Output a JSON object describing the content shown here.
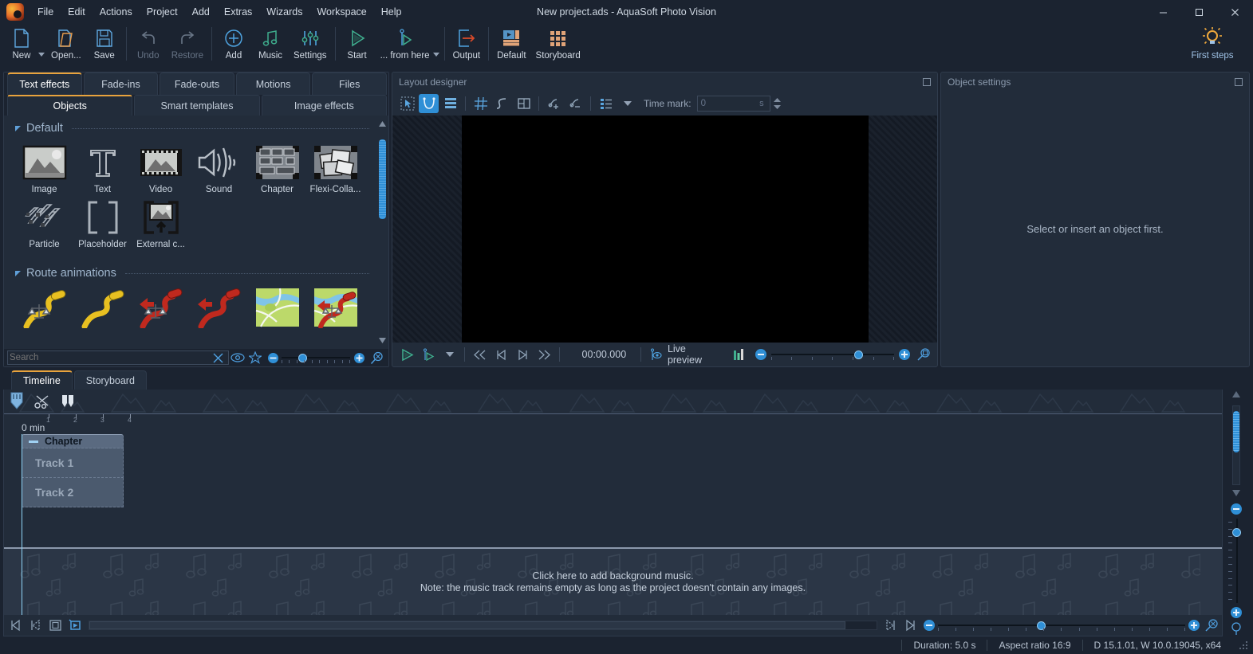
{
  "window": {
    "title": "New project.ads - AquaSoft Photo Vision",
    "minimize": "─",
    "maximize": "□",
    "close": "✕"
  },
  "menubar": {
    "items": [
      {
        "label": "File"
      },
      {
        "label": "Edit"
      },
      {
        "label": "Actions"
      },
      {
        "label": "Project"
      },
      {
        "label": "Add"
      },
      {
        "label": "Extras"
      },
      {
        "label": "Wizards"
      },
      {
        "label": "Workspace"
      },
      {
        "label": "Help"
      }
    ]
  },
  "ribbon": {
    "buttons": [
      {
        "label": "New",
        "icon": "new-document-icon",
        "disabled": false
      },
      {
        "label": "Open...",
        "icon": "open-folder-icon",
        "disabled": false
      },
      {
        "label": "Save",
        "icon": "floppy-disk-icon",
        "disabled": false
      },
      {
        "label": "Undo",
        "icon": "undo-arrow-icon",
        "disabled": true
      },
      {
        "label": "Restore",
        "icon": "redo-arrow-icon",
        "disabled": true
      },
      {
        "label": "Add",
        "icon": "plus-circle-icon",
        "disabled": false
      },
      {
        "label": "Music",
        "icon": "music-note-icon",
        "disabled": false
      },
      {
        "label": "Settings",
        "icon": "sliders-icon",
        "disabled": false
      },
      {
        "label": "Start",
        "icon": "play-triangle-icon",
        "disabled": false
      },
      {
        "label": "... from here",
        "icon": "play-from-here-icon",
        "disabled": false
      },
      {
        "label": "Output",
        "icon": "export-arrow-icon",
        "disabled": false
      },
      {
        "label": "Default",
        "icon": "default-layout-icon",
        "disabled": false
      },
      {
        "label": "Storyboard",
        "icon": "storyboard-grid-icon",
        "disabled": false
      }
    ],
    "first_steps": {
      "label": "First steps",
      "icon": "lightbulb-icon"
    }
  },
  "toolbox": {
    "tabs_row1": [
      {
        "label": "Text effects",
        "active": true
      },
      {
        "label": "Fade-ins",
        "active": false
      },
      {
        "label": "Fade-outs",
        "active": false
      },
      {
        "label": "Motions",
        "active": false
      },
      {
        "label": "Files",
        "active": false
      }
    ],
    "tabs_row2": [
      {
        "label": "Objects",
        "active": true
      },
      {
        "label": "Smart templates",
        "active": false
      },
      {
        "label": "Image effects",
        "active": false
      }
    ],
    "groups": [
      {
        "title": "Default",
        "items": [
          {
            "label": "Image",
            "icon": "image-thumb-icon"
          },
          {
            "label": "Text",
            "icon": "text-t-icon"
          },
          {
            "label": "Video",
            "icon": "video-filmstrip-icon"
          },
          {
            "label": "Sound",
            "icon": "speaker-wave-icon"
          },
          {
            "label": "Chapter",
            "icon": "chapter-blocks-icon"
          },
          {
            "label": "Flexi-Colla...",
            "icon": "flexi-collage-icon"
          },
          {
            "label": "Particle",
            "icon": "particle-icon"
          },
          {
            "label": "Placeholder",
            "icon": "placeholder-brackets-icon"
          },
          {
            "label": "External c...",
            "icon": "external-content-icon"
          }
        ]
      },
      {
        "title": "Route animations",
        "items": [
          {
            "label": "",
            "icon": "route-yellow-scale-icon"
          },
          {
            "label": "",
            "icon": "route-yellow-icon"
          },
          {
            "label": "",
            "icon": "route-red-scale-icon"
          },
          {
            "label": "",
            "icon": "route-red-icon"
          },
          {
            "label": "",
            "icon": "route-map-icon"
          },
          {
            "label": "",
            "icon": "route-map-red-icon"
          }
        ]
      }
    ],
    "search": {
      "placeholder": "Search",
      "value": "",
      "clear_icon": "clear-x-icon",
      "preview_icon": "eye-icon",
      "favorite_icon": "star-icon",
      "zoom_out_icon": "minus-circle-icon",
      "zoom_in_icon": "plus-circle-icon",
      "reset_zoom_icon": "magnifier-reset-icon",
      "zoom_value": 25
    }
  },
  "layout_designer": {
    "title": "Layout designer",
    "restore_icon": "restore-window-icon",
    "tools": [
      {
        "icon": "select-marquee-icon",
        "active": false
      },
      {
        "icon": "curve-tool-icon",
        "active": true
      },
      {
        "icon": "layers-icon",
        "active": false
      },
      {
        "icon": "grid-icon",
        "active": false
      },
      {
        "icon": "path-icon",
        "active": false
      },
      {
        "icon": "frame-icon",
        "active": false
      },
      {
        "icon": "add-point-icon",
        "active": false
      },
      {
        "icon": "remove-point-icon",
        "active": false
      },
      {
        "icon": "list-icon",
        "active": false
      }
    ],
    "time_mark": {
      "label": "Time mark:",
      "value": "0",
      "unit": "s"
    },
    "transport": {
      "play_icon": "play-icon",
      "play_from_here_icon": "play-from-here-icon",
      "dropdown_icon": "chevron-down-icon",
      "rewind_icon": "rewind-icon",
      "prev_icon": "previous-frame-icon",
      "next_icon": "next-frame-icon",
      "forward_icon": "fast-forward-icon",
      "timecode": "00:00.000",
      "live_preview_label": "Live preview",
      "live_preview_icon": "live-preview-icon",
      "audio_meter_icon": "audio-meter-icon",
      "zoom_out_icon": "minus-circle-icon",
      "zoom_in_icon": "plus-circle-icon",
      "fit_icon": "magnifier-fit-icon",
      "zoom_value": 62
    }
  },
  "object_settings": {
    "title": "Object settings",
    "restore_icon": "restore-window-icon",
    "empty_message": "Select or insert an object first."
  },
  "timeline": {
    "tabs": [
      {
        "label": "Timeline",
        "active": true
      },
      {
        "label": "Storyboard",
        "active": false
      }
    ],
    "tools": [
      {
        "icon": "playhead-marker-icon"
      },
      {
        "icon": "scissors-icon"
      },
      {
        "icon": "split-markers-icon"
      }
    ],
    "ruler": {
      "ticks": [
        "1",
        "2",
        "3",
        "4"
      ],
      "unit_label": "0 min"
    },
    "tracks": [
      {
        "label": "Chapter",
        "type": "chapter"
      },
      {
        "label": "Track 1",
        "type": "track"
      },
      {
        "label": "Track 2",
        "type": "track"
      }
    ],
    "music_track": {
      "line1": "Click here to add background music.",
      "line2": "Note: the music track remains empty as long as the project doesn't contain any images."
    },
    "bottom_controls": {
      "goto_start_icon": "goto-start-icon",
      "step_back_icon": "step-back-icon",
      "fit_frame_icon": "fit-frame-icon",
      "preview_icon": "preview-window-icon",
      "step_forward_icon": "step-forward-icon",
      "goto_end_icon": "goto-end-icon",
      "zoom_out_icon": "minus-circle-icon",
      "zoom_in_icon": "plus-circle-icon",
      "fit_icon": "magnifier-fit-icon",
      "zoom_value": 40
    },
    "vertical_controls": {
      "zoom_out_icon": "minus-circle-icon",
      "zoom_in_icon": "plus-circle-icon",
      "fit_icon": "magnifier-fit-icon",
      "zoom_value": 80
    }
  },
  "statusbar": {
    "duration": "Duration: 5.0 s",
    "aspect_ratio": "Aspect ratio 16:9",
    "version": "D 15.1.01, W 10.0.19045, x64",
    "grip_icon": "resize-grip-icon"
  },
  "colors": {
    "accent_blue": "#2f8fd6",
    "accent_orange": "#e8a33d",
    "bg_dark": "#1b2330",
    "panel": "#222c3a",
    "green": "#3fae8e"
  }
}
